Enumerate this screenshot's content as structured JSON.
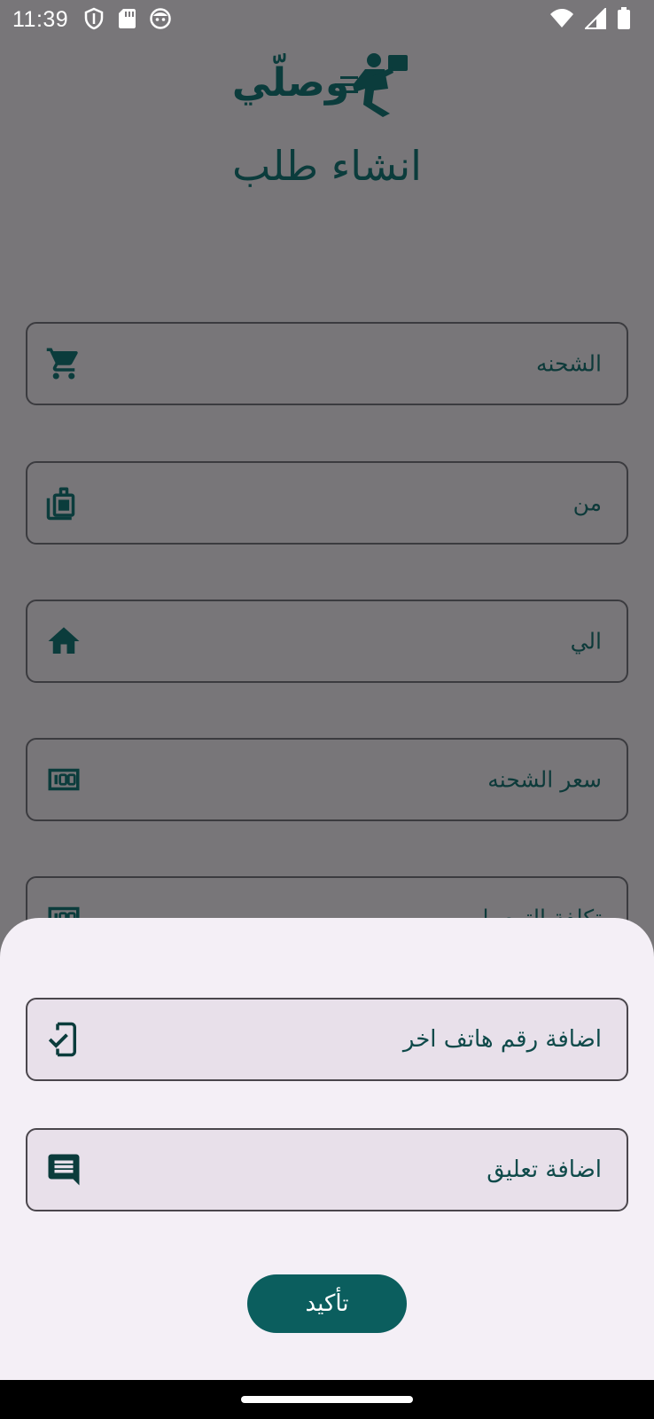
{
  "status_bar": {
    "time": "11:39",
    "left_icons": [
      "shield-icon",
      "sd-card-icon",
      "face-icon"
    ],
    "right_icons": [
      "wifi-icon",
      "signal-icon",
      "battery-icon"
    ]
  },
  "header": {
    "logo_text": "وصلّي",
    "title": "انشاء طلب"
  },
  "form": {
    "fields": [
      {
        "label": "الشحنه",
        "icon": "cart-icon"
      },
      {
        "label": "من",
        "icon": "bag-icon"
      },
      {
        "label": "الي",
        "icon": "home-icon"
      },
      {
        "label": "سعر الشحنه",
        "icon": "money-icon"
      },
      {
        "label": "تكلفة التوصيل",
        "icon": "money-icon"
      }
    ]
  },
  "sheet": {
    "phone_field": {
      "label": "اضافة رقم هاتف اخر",
      "icon": "phone-check-icon"
    },
    "comment_field": {
      "label": "اضافة تعليق",
      "icon": "comment-icon"
    },
    "confirm_label": "تأكيد"
  },
  "colors": {
    "accent": "#0b5e5e",
    "scrim": "#787679",
    "sheet_bg": "#f4eff6",
    "field_bg": "#e8e0ea"
  }
}
